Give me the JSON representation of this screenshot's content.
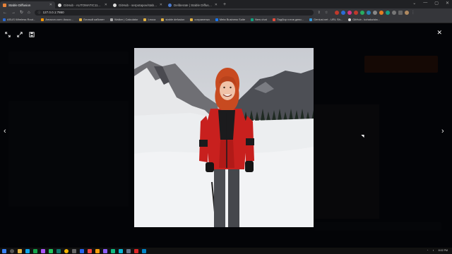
{
  "browser": {
    "tabs": [
      {
        "label": "Stable Diffusion",
        "icon": "sd-icon",
        "active": true
      },
      {
        "label": "GitHub - AUTOMATIC1111/stabl...",
        "icon": "github-icon",
        "active": false
      },
      {
        "label": "GitHub - serpotapov/stable-diff...",
        "icon": "github-icon",
        "active": false
      },
      {
        "label": "Deliberate | Stable Diffusion Che...",
        "icon": "deliberate-icon",
        "active": false
      }
    ],
    "new_tab": "+",
    "url": "127.0.0.1:7860",
    "bookmarks": [
      "ASUS Wireless Rout...",
      "Amazon.com: Assoc...",
      "Личный кабинет",
      "Walker | Calculator",
      "Leoca",
      "stable defusion",
      "сохраненка",
      "Meta Business Suite",
      "New chat",
      "Подбор готов дево...",
      "Geniust.net - URL Sh...",
      "GitHub - kohaku/sta..."
    ]
  },
  "lightbox": {
    "image_alt": "Woman with curly red hair in a red and black ski jacket standing on a snowy field with mountains behind",
    "accent_jacket": "#c8201e",
    "accent_hair": "#c84a20"
  },
  "taskbar": {
    "clock": "8:02 PM"
  }
}
